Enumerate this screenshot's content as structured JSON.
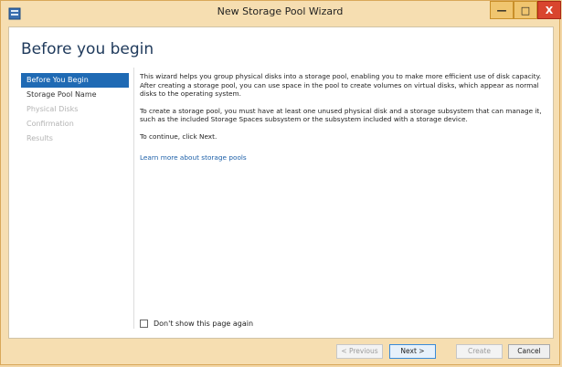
{
  "window": {
    "title": "New Storage Pool Wizard",
    "controls": {
      "minimize_glyph": "—",
      "maximize_glyph": "□",
      "close_glyph": "X"
    }
  },
  "page": {
    "title": "Before you begin"
  },
  "nav": {
    "items": [
      {
        "label": "Before You Begin",
        "state": "active"
      },
      {
        "label": "Storage Pool Name",
        "state": "enabled"
      },
      {
        "label": "Physical Disks",
        "state": "disabled"
      },
      {
        "label": "Confirmation",
        "state": "disabled"
      },
      {
        "label": "Results",
        "state": "disabled"
      }
    ]
  },
  "content": {
    "paragraph1": "This wizard helps you group physical disks into a storage pool, enabling you to make more efficient use of disk capacity. After creating a storage pool, you can use space in the pool to create volumes on virtual disks, which appear as normal disks to the operating system.",
    "paragraph2": "To create a storage pool, you must have at least one unused physical disk and a storage subsystem that can manage it, such as the included Storage Spaces subsystem or the subsystem included with a storage device.",
    "paragraph3": "To continue, click Next.",
    "link": "Learn more about storage pools"
  },
  "checkbox": {
    "label": "Don't show this page again",
    "checked": false
  },
  "footer": {
    "previous_label": "< Previous",
    "next_label": "Next >",
    "create_label": "Create",
    "cancel_label": "Cancel"
  },
  "colors": {
    "accent": "#1f6ab4",
    "window_chrome": "#f6deb1",
    "close_button": "#d9452e",
    "title_text": "#1e395b"
  },
  "icons": {
    "app": "server-manager-icon"
  }
}
